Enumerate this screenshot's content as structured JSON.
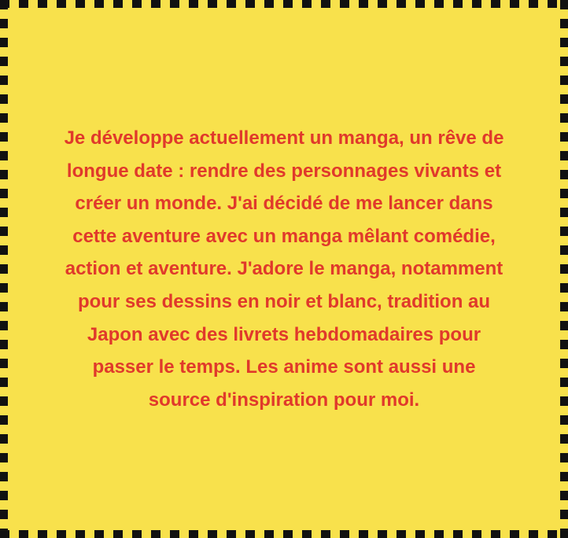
{
  "card": {
    "lines": [
      "Je développe actuellement un manga, un rêve de",
      "longue date : rendre des personnages vivants et",
      "créer un monde. J'ai décidé de me lancer dans",
      "cette aventure avec un manga mêlant comédie,",
      "action et aventure. J'adore le manga, notamment",
      "pour ses dessins en noir et blanc, tradition au",
      "Japon avec des livrets hebdomadaires pour",
      "passer le temps. Les anime sont aussi une",
      "source d'inspiration pour moi."
    ]
  },
  "colors": {
    "background": "#f8e14c",
    "text": "#e0392b",
    "border": "#111111"
  }
}
